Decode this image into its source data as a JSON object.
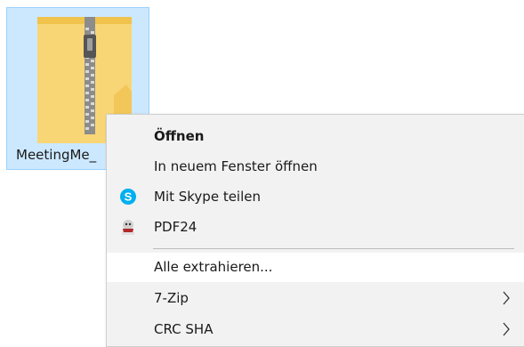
{
  "file": {
    "name": "MeetingMe_",
    "icon": "zip-folder-icon"
  },
  "menu": {
    "items": [
      {
        "label": "Öffnen",
        "icon": "",
        "bold": true
      },
      {
        "label": "In neuem Fenster öffnen",
        "icon": ""
      },
      {
        "label": "Mit Skype teilen",
        "icon": "skype-icon"
      },
      {
        "label": "PDF24",
        "icon": "pdf24-icon"
      },
      {
        "label": "Alle extrahieren...",
        "icon": ""
      },
      {
        "label": "7-Zip",
        "icon": "",
        "submenu": true
      },
      {
        "label": "CRC SHA",
        "icon": "",
        "submenu": true
      }
    ]
  },
  "colors": {
    "selection_background": "#cce8ff",
    "selection_border": "#99d1ff",
    "menu_background": "#f2f2f2",
    "menu_hover": "#ffffff",
    "skype_blue": "#00aff0",
    "folder_yellow": "#f8d675"
  }
}
